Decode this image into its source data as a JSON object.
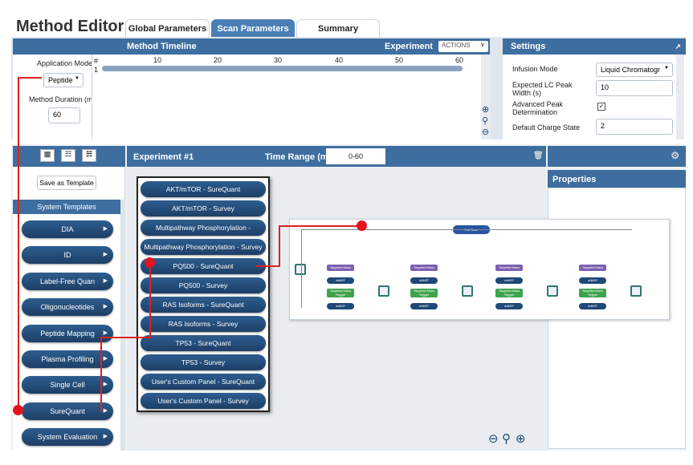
{
  "header": {
    "title": "Method Editor",
    "tabs": [
      {
        "label": "Global Parameters",
        "active": false
      },
      {
        "label": "Scan Parameters",
        "active": true
      },
      {
        "label": "Summary",
        "active": false
      }
    ]
  },
  "timeline": {
    "title": "Method Timeline",
    "experiment_label": "Experiment",
    "actions_label": "ACTIONS",
    "application_mode_label": "Application Mode",
    "application_mode_value": "Peptide",
    "duration_label": "Method Duration (min)",
    "duration_value": "60",
    "hash": "#",
    "row_number": "1",
    "ticks": [
      "10",
      "20",
      "30",
      "40",
      "50",
      "60"
    ]
  },
  "settings": {
    "title": "Settings",
    "infusion_mode_label": "Infusion Mode",
    "infusion_mode_value": "Liquid Chromatogr",
    "peak_width_label": "Expected LC Peak Width (s)",
    "peak_width_value": "10",
    "advanced_peak_label": "Advanced Peak Determination",
    "default_charge_label": "Default Charge State",
    "default_charge_value": "2"
  },
  "experiment": {
    "title": "Experiment #1",
    "time_range_label": "Time Range (min)",
    "time_range_value": "0-60"
  },
  "properties": {
    "title": "Properties"
  },
  "sidebar": {
    "save_template": "Save as Template",
    "system_templates": "System Templates",
    "items": [
      "DIA",
      "ID",
      "Label-Free Quan",
      "Oligonucleotides",
      "Peptide Mapping",
      "Plasma Profiling",
      "Single Cell",
      "SureQuant",
      "System Evaluation"
    ]
  },
  "template_list": [
    "AKT/mTOR - SureQuant",
    "AKT/mTOR - Survey",
    "Multipathway Phosphorylation - SureQuant",
    "Multipathway Phosphorylation - Survey",
    "PQ500 - SureQuant",
    "PQ500 - Survey",
    "RAS Isoforms - SureQuant",
    "RAS Isoforms - Survey",
    "TP53 - SureQuant",
    "TP53 - Survey",
    "User's Custom Panel - SureQuant",
    "User's Custom Panel - Survey"
  ],
  "diagram": {
    "root": "Full Scan",
    "branch_top": "Targeted Mass",
    "branch_mid": "ddMS²",
    "branch_green": "Targeted Mass Trigger",
    "branch_bottom": "ddMS²"
  },
  "colors": {
    "header_bar": "#3e6e9f",
    "accent_red": "#e3141e",
    "pill_blue": "#1d3f66"
  }
}
